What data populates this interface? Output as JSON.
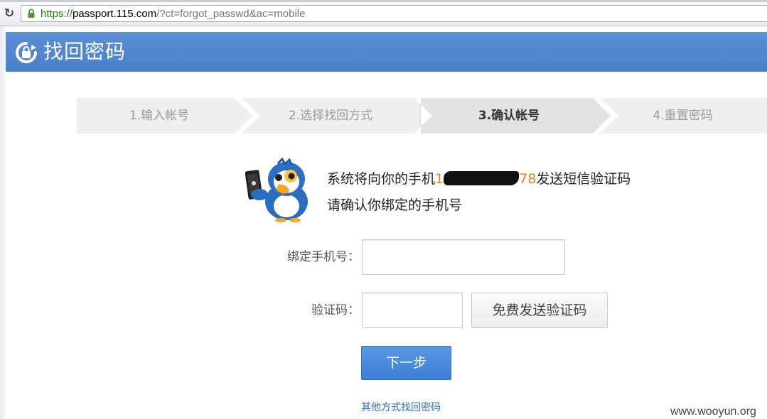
{
  "browser": {
    "url_scheme": "https://",
    "url_host": "passport.115.com",
    "url_path": "/?ct=forgot_passwd&ac=mobile",
    "reload_icon": "reload-icon",
    "lock_icon": "lock-icon"
  },
  "header": {
    "title": "找回密码",
    "logo_icon": "lock-refresh-icon"
  },
  "steps": [
    {
      "label": "1.输入帐号",
      "active": false
    },
    {
      "label": "2.选择找回方式",
      "active": false
    },
    {
      "label": "3.确认帐号",
      "active": true
    },
    {
      "label": "4.重置密码",
      "active": false
    }
  ],
  "message": {
    "line1_prefix": "系统将向你的手机",
    "phone_start": "1",
    "phone_end": "78",
    "line1_suffix": "发送短信验证码",
    "line2": "请确认你绑定的手机号",
    "mascot_icon": "bird-mascot-with-phone-icon"
  },
  "form": {
    "phone_label": "绑定手机号：",
    "phone_value": "",
    "code_label": "验证码：",
    "code_value": "",
    "send_button": "免费发送验证码",
    "next_button": "下一步",
    "other_link": "其他方式找回密码"
  },
  "watermark": "www.wooyun.org",
  "colors": {
    "header_blue": "#4a7fcb",
    "button_blue": "#3d7ed6",
    "phone_highlight": "#e87e1e",
    "link_blue": "#2c6bc0"
  }
}
